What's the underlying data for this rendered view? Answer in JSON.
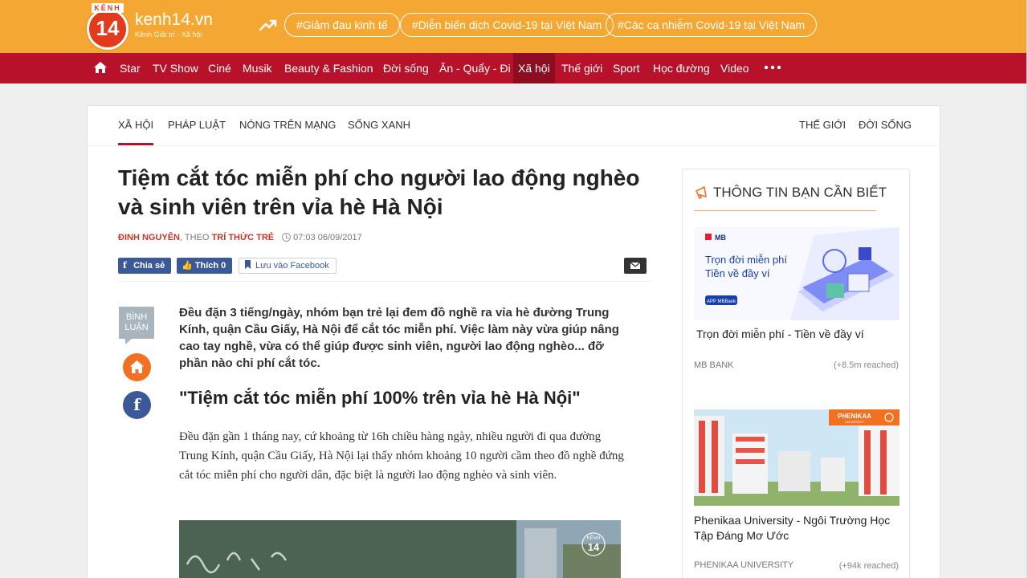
{
  "header": {
    "logo_top": "KÊNH",
    "logo_number": "14",
    "brand": "kenh14.vn",
    "tagline": "Kênh Giải trí - Xã hội",
    "trending_icon": "trending-up-icon",
    "tags": [
      "#Giảm đau kinh tế",
      "#Diễn biến dịch Covid-19 tại Việt Nam",
      "#Các ca nhiễm Covid-19 tại Việt Nam"
    ]
  },
  "nav": {
    "home_icon": "home-icon",
    "items": [
      "Star",
      "TV Show",
      "Ciné",
      "Musik",
      "Beauty & Fashion",
      "Đời sống",
      "Ăn - Quẩy - Đi",
      "Xã hội",
      "Thế giới",
      "Sport",
      "Học đường",
      "Video"
    ],
    "active": "Xã hội",
    "more_icon": "more-dots-icon"
  },
  "subnav": {
    "left": [
      "XÃ HỘI",
      "PHÁP LUẬT",
      "NÓNG TRÊN MẠNG",
      "SỐNG XANH"
    ],
    "right": [
      "THẾ GIỚI",
      "ĐỜI SỐNG"
    ]
  },
  "article": {
    "title": "Tiệm cắt tóc miễn phí cho người lao động nghèo và sinh viên trên vỉa hè Hà Nội",
    "author": "ĐINH NGUYÊN",
    "via": ", THEO ",
    "source": "TRÍ THỨC TRẺ",
    "time": "07:03 06/09/2017",
    "share_label": "Chia sẻ",
    "like_label": "Thích 0",
    "save_label": "Lưu vào Facebook",
    "comment_label_1": "BÌNH",
    "comment_label_2": "LUẬN",
    "sapo": "Đều đặn 3 tiếng/ngày, nhóm bạn trẻ lại đem đồ nghề ra vỉa hè đường Trung Kính, quận Cầu Giấy, Hà Nội để cắt tóc miễn phí. Việc làm này vừa giúp nâng cao tay nghề, vừa có thể giúp được sinh viên, người lao động nghèo... đỡ phần nào chi phí cắt tóc.",
    "heading": "\"Tiệm cắt tóc miễn phí 100% trên vỉa hè Hà Nội\"",
    "body": "Đều đặn gần 1 tháng nay, cứ khoảng từ 16h chiều hàng ngày, nhiều người đi qua đường Trung Kính, quận Cầu Giấy, Hà Nội lại thấy nhóm khoảng 10 người cầm theo đồ nghề đứng cắt tóc miễn phí cho người dân, đặc biệt là người lao động nghèo và sinh viên.",
    "photo_watermark_top": "KÊNH",
    "photo_watermark_num": "14"
  },
  "sidebar": {
    "title": "THÔNG TIN BẠN CẦN BIẾT",
    "ads": [
      {
        "brand_mark": "MB",
        "headline_1": "Trọn đời miễn phí",
        "headline_2": "Tiền về đầy ví",
        "app_badge": "APP MBBank",
        "title": "Trọn đời miễn phí - Tiền về đầy ví",
        "source": "MB BANK",
        "reach": "(+8.5m reached)"
      },
      {
        "brand_mark": "PHENIKAA",
        "brand_sub": "UNIVERSITY",
        "title": "Phenikaa University - Ngôi Trường Học Tập Đáng Mơ Ước",
        "source": "PHENIKAA UNIVERSITY",
        "reach": "(+94k reached)"
      }
    ]
  },
  "colors": {
    "header_orange": "#f4a833",
    "nav_red": "#b8112a",
    "facebook_blue": "#3b5998",
    "accent_red": "#c0392b"
  }
}
